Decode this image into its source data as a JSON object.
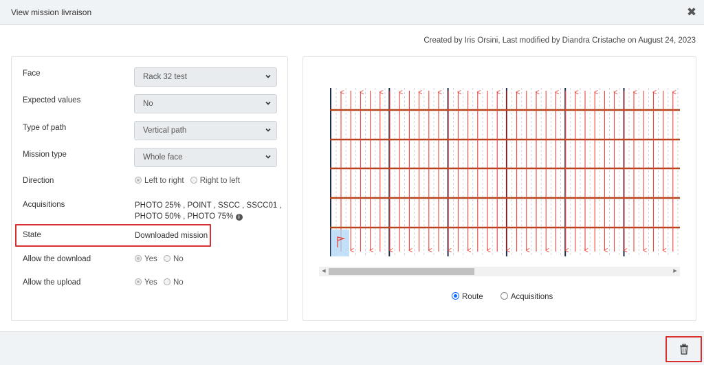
{
  "modal": {
    "title": "View mission livraison",
    "close_icon": "close-icon"
  },
  "meta": "Created by Iris Orsini, Last modified by Diandra Cristache on August 24, 2023",
  "form": {
    "face": {
      "label": "Face",
      "value": "Rack 32 test"
    },
    "expected_values": {
      "label": "Expected values",
      "value": "No"
    },
    "type_of_path": {
      "label": "Type of path",
      "value": "Vertical path"
    },
    "mission_type": {
      "label": "Mission type",
      "value": "Whole face"
    },
    "direction": {
      "label": "Direction",
      "options": [
        "Left to right",
        "Right to left"
      ],
      "selected": "Left to right"
    },
    "acquisitions": {
      "label": "Acquisitions",
      "line1": "PHOTO 25% , POINT , SSCC , SSCC01 ,",
      "line2": "PHOTO 50% , PHOTO 75%",
      "info_icon": "info-icon"
    },
    "state": {
      "label": "State",
      "value": "Downloaded mission"
    },
    "allow_download": {
      "label": "Allow the download",
      "options": [
        "Yes",
        "No"
      ],
      "selected": "Yes"
    },
    "allow_upload": {
      "label": "Allow the upload",
      "options": [
        "Yes",
        "No"
      ],
      "selected": "Yes"
    }
  },
  "view": {
    "options": [
      "Route",
      "Acquisitions"
    ],
    "selected": "Route"
  },
  "footer": {
    "delete_icon": "trash-icon"
  },
  "colors": {
    "accent": "#0d6efd",
    "highlight": "#d9302f",
    "route": "#e8443a",
    "shelf": "#b5441a",
    "column": "#1f2d4d"
  }
}
